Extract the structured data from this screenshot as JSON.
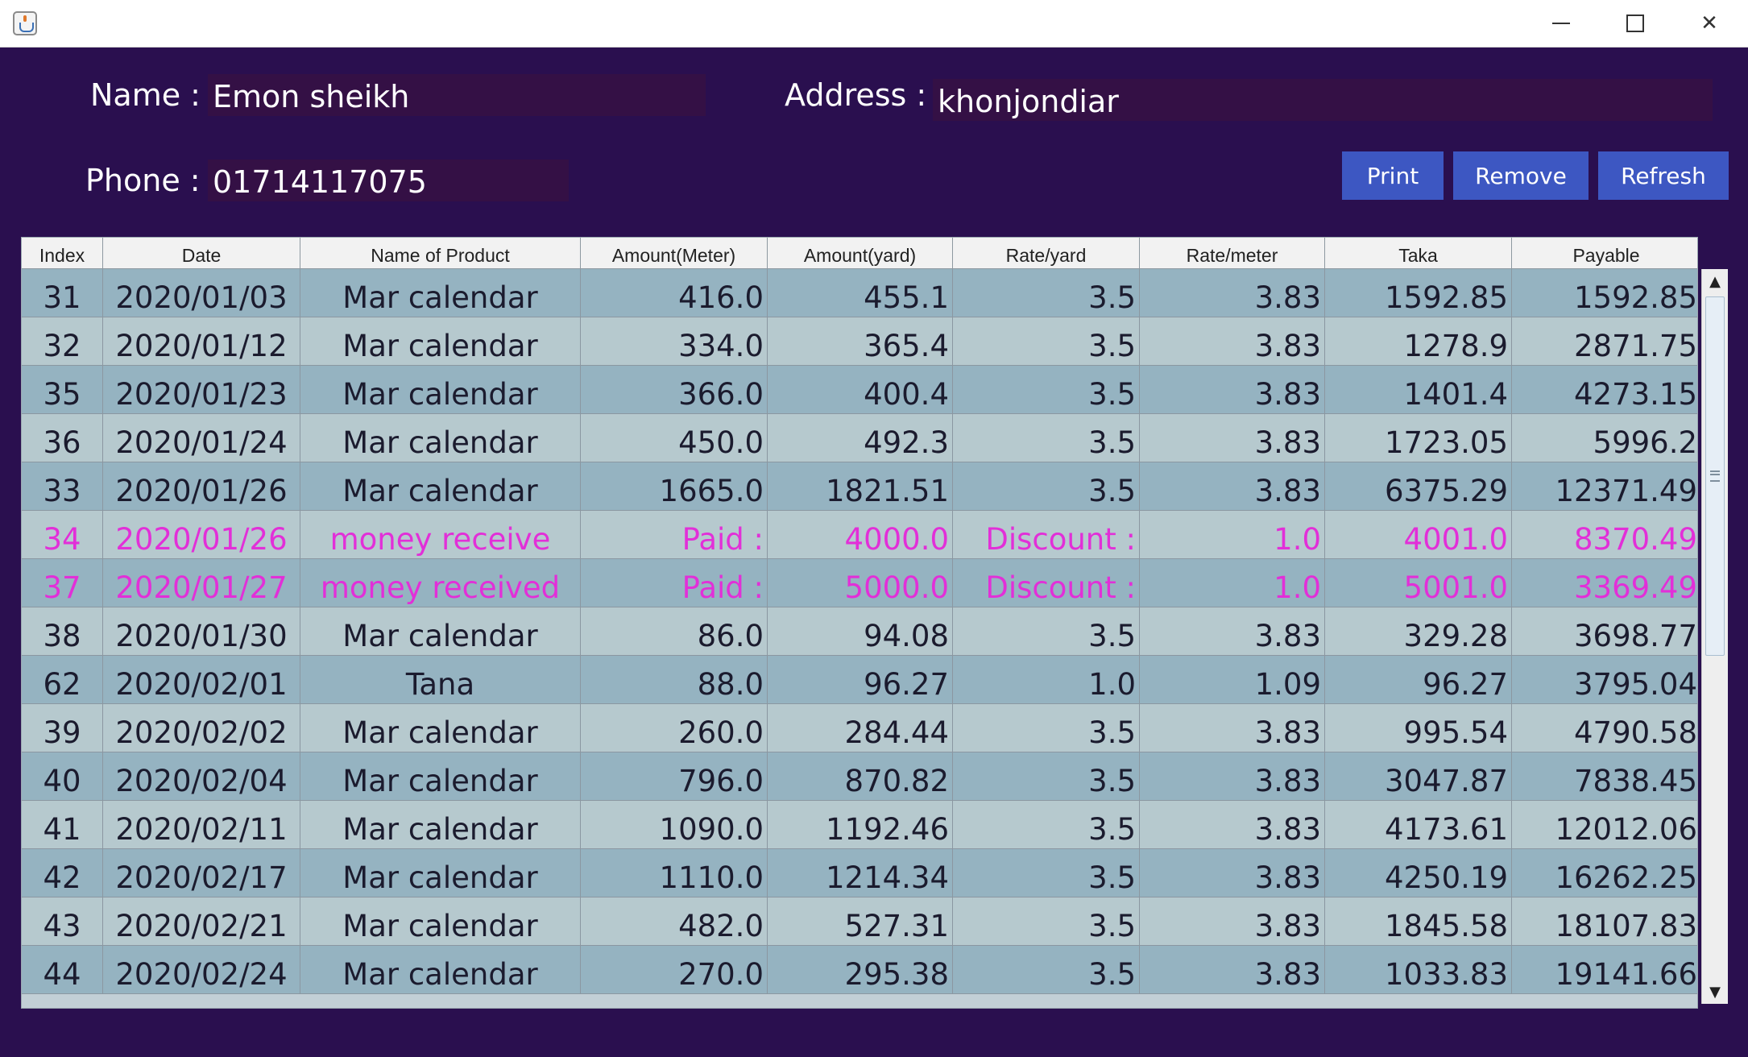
{
  "window": {
    "app_icon": "java-cup-icon",
    "controls": {
      "minimize": "minimize-icon",
      "maximize": "maximize-icon",
      "close": "close-icon",
      "close_glyph": "✕"
    }
  },
  "customer": {
    "name_label": "Name :",
    "name_value": "Emon sheikh",
    "address_label": "Address :",
    "address_value": "khonjondiar",
    "phone_label": "Phone :",
    "phone_value": "01714117075"
  },
  "toolbar": {
    "print_label": "Print",
    "remove_label": "Remove",
    "refresh_label": "Refresh"
  },
  "table": {
    "columns": [
      "Index",
      "Date",
      "Name of Product",
      "Amount(Meter)",
      "Amount(yard)",
      "Rate/yard",
      "Rate/meter",
      "Taka",
      "Payable"
    ],
    "rows": [
      {
        "index": "31",
        "date": "2020/01/03",
        "product": "Mar calendar",
        "meter": "416.0",
        "yard": "455.1",
        "rate_yard": "3.5",
        "rate_meter": "3.83",
        "taka": "1592.85",
        "payable": "1592.85",
        "highlight": false
      },
      {
        "index": "32",
        "date": "2020/01/12",
        "product": "Mar calendar",
        "meter": "334.0",
        "yard": "365.4",
        "rate_yard": "3.5",
        "rate_meter": "3.83",
        "taka": "1278.9",
        "payable": "2871.75",
        "highlight": false
      },
      {
        "index": "35",
        "date": "2020/01/23",
        "product": "Mar calendar",
        "meter": "366.0",
        "yard": "400.4",
        "rate_yard": "3.5",
        "rate_meter": "3.83",
        "taka": "1401.4",
        "payable": "4273.15",
        "highlight": false
      },
      {
        "index": "36",
        "date": "2020/01/24",
        "product": "Mar calendar",
        "meter": "450.0",
        "yard": "492.3",
        "rate_yard": "3.5",
        "rate_meter": "3.83",
        "taka": "1723.05",
        "payable": "5996.2",
        "highlight": false
      },
      {
        "index": "33",
        "date": "2020/01/26",
        "product": "Mar calendar",
        "meter": "1665.0",
        "yard": "1821.51",
        "rate_yard": "3.5",
        "rate_meter": "3.83",
        "taka": "6375.29",
        "payable": "12371.49",
        "highlight": false
      },
      {
        "index": "34",
        "date": "2020/01/26",
        "product": "money receive",
        "meter": "Paid :",
        "yard": "4000.0",
        "rate_yard": "Discount :",
        "rate_meter": "1.0",
        "taka": "4001.0",
        "payable": "8370.49",
        "highlight": true
      },
      {
        "index": "37",
        "date": "2020/01/27",
        "product": "money received",
        "meter": "Paid :",
        "yard": "5000.0",
        "rate_yard": "Discount :",
        "rate_meter": "1.0",
        "taka": "5001.0",
        "payable": "3369.49",
        "highlight": true
      },
      {
        "index": "38",
        "date": "2020/01/30",
        "product": "Mar calendar",
        "meter": "86.0",
        "yard": "94.08",
        "rate_yard": "3.5",
        "rate_meter": "3.83",
        "taka": "329.28",
        "payable": "3698.77",
        "highlight": false
      },
      {
        "index": "62",
        "date": "2020/02/01",
        "product": "Tana",
        "meter": "88.0",
        "yard": "96.27",
        "rate_yard": "1.0",
        "rate_meter": "1.09",
        "taka": "96.27",
        "payable": "3795.04",
        "highlight": false
      },
      {
        "index": "39",
        "date": "2020/02/02",
        "product": "Mar calendar",
        "meter": "260.0",
        "yard": "284.44",
        "rate_yard": "3.5",
        "rate_meter": "3.83",
        "taka": "995.54",
        "payable": "4790.58",
        "highlight": false
      },
      {
        "index": "40",
        "date": "2020/02/04",
        "product": "Mar calendar",
        "meter": "796.0",
        "yard": "870.82",
        "rate_yard": "3.5",
        "rate_meter": "3.83",
        "taka": "3047.87",
        "payable": "7838.45",
        "highlight": false
      },
      {
        "index": "41",
        "date": "2020/02/11",
        "product": "Mar calendar",
        "meter": "1090.0",
        "yard": "1192.46",
        "rate_yard": "3.5",
        "rate_meter": "3.83",
        "taka": "4173.61",
        "payable": "12012.06",
        "highlight": false
      },
      {
        "index": "42",
        "date": "2020/02/17",
        "product": "Mar calendar",
        "meter": "1110.0",
        "yard": "1214.34",
        "rate_yard": "3.5",
        "rate_meter": "3.83",
        "taka": "4250.19",
        "payable": "16262.25",
        "highlight": false
      },
      {
        "index": "43",
        "date": "2020/02/21",
        "product": "Mar calendar",
        "meter": "482.0",
        "yard": "527.31",
        "rate_yard": "3.5",
        "rate_meter": "3.83",
        "taka": "1845.58",
        "payable": "18107.83",
        "highlight": false
      },
      {
        "index": "44",
        "date": "2020/02/24",
        "product": "Mar calendar",
        "meter": "270.0",
        "yard": "295.38",
        "rate_yard": "3.5",
        "rate_meter": "3.83",
        "taka": "1033.83",
        "payable": "19141.66",
        "highlight": false
      }
    ]
  },
  "scrollbar": {
    "up_icon": "scroll-up-arrow-icon",
    "down_icon": "scroll-down-arrow-icon",
    "up_glyph": "▲",
    "down_glyph": "▼"
  },
  "colors": {
    "window_background": "#2a0f4f",
    "field_background": "#341045",
    "button_background": "#3d57c2",
    "row_dark": "#95b3c1",
    "row_light": "#b6c9ce",
    "highlight_text": "#e22fd8"
  }
}
